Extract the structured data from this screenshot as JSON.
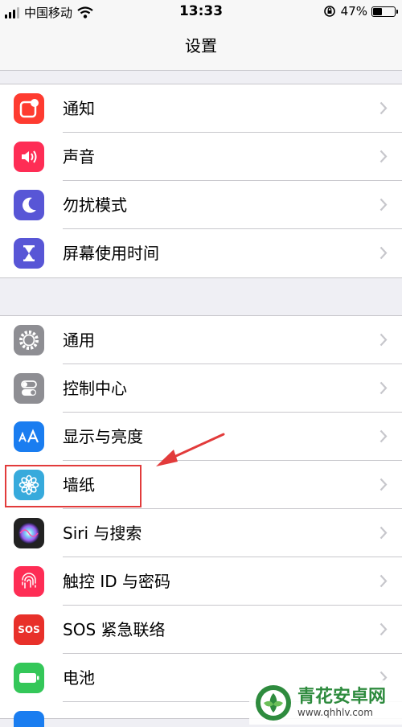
{
  "status_bar": {
    "carrier": "中国移动",
    "time": "13:33",
    "battery": "47%",
    "battery_level": 0.47
  },
  "nav": {
    "title": "设置"
  },
  "groups": [
    {
      "items": [
        {
          "label": "通知",
          "icon": "notifications-icon",
          "color": "#fe3b30"
        },
        {
          "label": "声音",
          "icon": "sounds-icon",
          "color": "#fe2d55"
        },
        {
          "label": "勿扰模式",
          "icon": "moon-icon",
          "color": "#5856d6"
        },
        {
          "label": "屏幕使用时间",
          "icon": "hourglass-icon",
          "color": "#5856d6"
        }
      ]
    },
    {
      "items": [
        {
          "label": "通用",
          "icon": "gear-icon",
          "color": "#8e8e93"
        },
        {
          "label": "控制中心",
          "icon": "toggles-icon",
          "color": "#8e8e93"
        },
        {
          "label": "显示与亮度",
          "icon": "text-size-icon",
          "color": "#1a7df0"
        },
        {
          "label": "墙纸",
          "icon": "flower-icon",
          "color": "#37aadc"
        },
        {
          "label": "Siri 与搜索",
          "icon": "siri-icon",
          "color": "#222222"
        },
        {
          "label": "触控 ID 与密码",
          "icon": "fingerprint-icon",
          "color": "#fe2d55"
        },
        {
          "label": "SOS 紧急联络",
          "icon": "sos-icon",
          "color": "#e8302a",
          "icon_text": "SOS"
        },
        {
          "label": "电池",
          "icon": "battery-icon",
          "color": "#34c759"
        }
      ]
    }
  ],
  "annotation": {
    "highlight_color": "#e23b3b"
  },
  "watermark": {
    "name": "青花安卓网",
    "url": "www.qhhlv.com"
  }
}
